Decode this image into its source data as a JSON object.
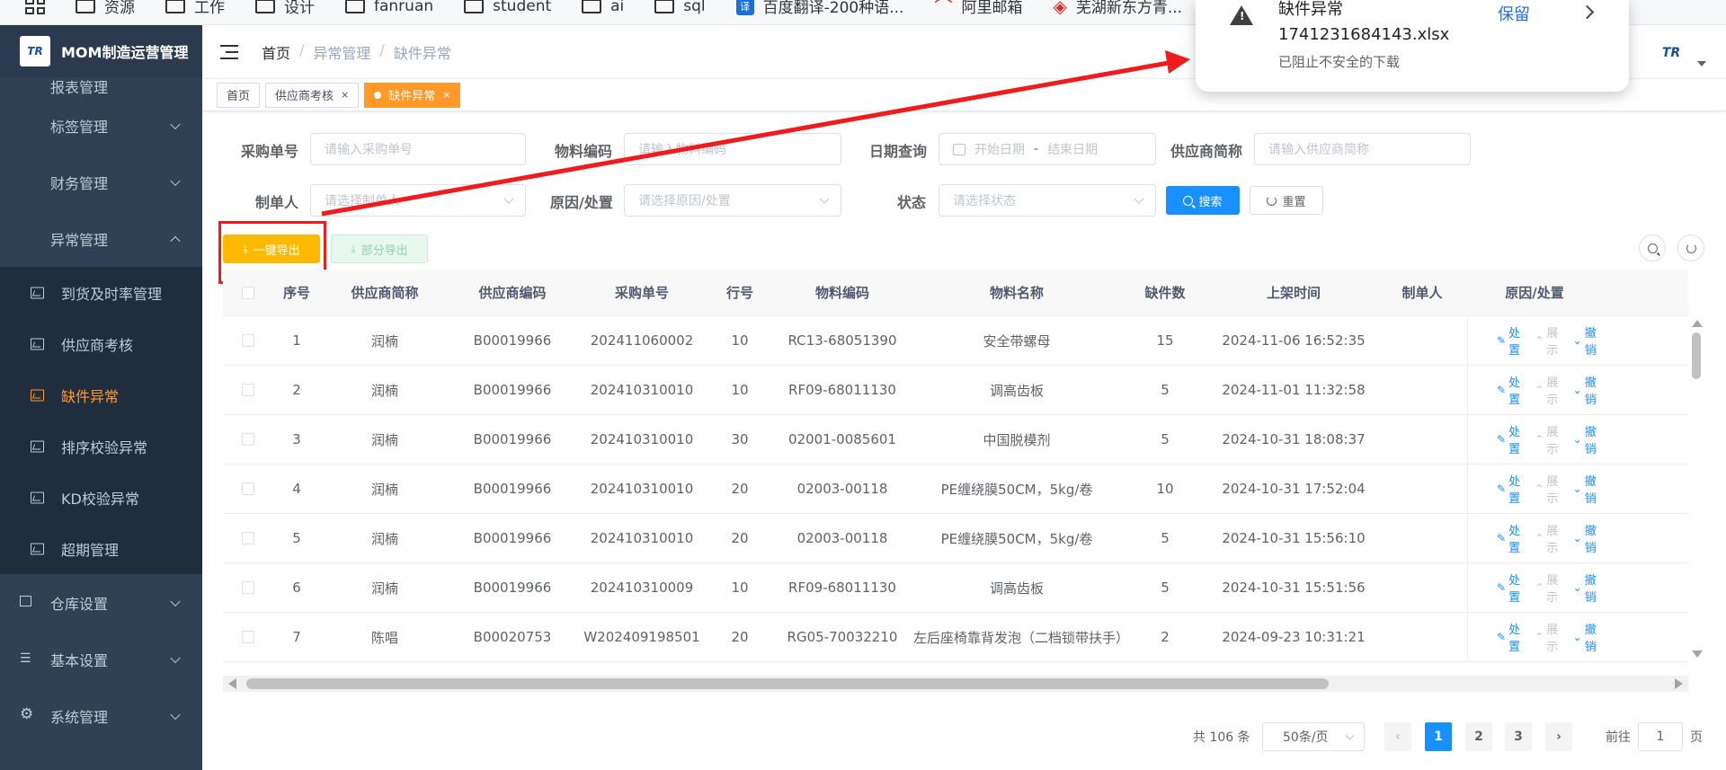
{
  "bookmarks": [
    {
      "icon": "grid-icon",
      "label": ""
    },
    {
      "icon": "folder-icon",
      "label": "资源"
    },
    {
      "icon": "folder-icon",
      "label": "工作"
    },
    {
      "icon": "folder-icon",
      "label": "设计"
    },
    {
      "icon": "folder-icon",
      "label": "fanruan"
    },
    {
      "icon": "folder-icon",
      "label": "student"
    },
    {
      "icon": "folder-icon",
      "label": "ai"
    },
    {
      "icon": "folder-icon",
      "label": "sql"
    },
    {
      "icon": "translate-icon",
      "badge": "译",
      "label": "百度翻译-200种语..."
    },
    {
      "icon": "aliyun-mail-icon",
      "label": "阿里邮箱"
    },
    {
      "icon": "neworiental-icon",
      "label": "芜湖新东方青..."
    }
  ],
  "app": {
    "logo_text": "TR",
    "title": "MOM制造运营管理"
  },
  "sidebar": {
    "partial_top": "报表管理",
    "menus_before": [
      {
        "label": "标签管理"
      },
      {
        "label": "财务管理"
      },
      {
        "label": "异常管理"
      }
    ],
    "sub_items": [
      {
        "label": "到货及时率管理"
      },
      {
        "label": "供应商考核"
      },
      {
        "label": "缺件异常"
      },
      {
        "label": "排序校验异常"
      },
      {
        "label": "KD校验异常"
      },
      {
        "label": "超期管理"
      }
    ],
    "menus_after": [
      {
        "label": "仓库设置"
      },
      {
        "label": "基本设置"
      },
      {
        "label": "系统管理"
      }
    ]
  },
  "navbar": {
    "breadcrumb": [
      "首页",
      "异常管理",
      "缺件异常"
    ],
    "separator": "/",
    "avatar_text": "TR"
  },
  "tags": [
    {
      "label": "首页",
      "closable": false
    },
    {
      "label": "供应商考核",
      "closable": true
    },
    {
      "label": "缺件异常",
      "closable": true
    }
  ],
  "filters": {
    "po_label": "采购单号",
    "po_placeholder": "请输入采购单号",
    "material_label": "物料编码",
    "material_placeholder": "请输入物料编码",
    "date_label": "日期查询",
    "date_start": "开始日期",
    "date_sep": "-",
    "date_end": "结束日期",
    "supplier_label": "供应商简称",
    "supplier_placeholder": "请输入供应商简称",
    "creator_label": "制单人",
    "creator_placeholder": "请选择制单人",
    "reason_label": "原因/处置",
    "reason_placeholder": "请选择原因/处置",
    "status_label": "状态",
    "status_placeholder": "请选择状态",
    "search_btn": "搜索",
    "reset_btn": "重置"
  },
  "toolbar": {
    "export_all": "一键导出",
    "export_partial": "部分导出"
  },
  "table": {
    "headers": [
      "序号",
      "供应商简称",
      "供应商编码",
      "采购单号",
      "行号",
      "物料编码",
      "物料名称",
      "缺件数",
      "上架时间",
      "制单人",
      "原因/处置"
    ],
    "rows": [
      [
        "1",
        "润楠",
        "B00019966",
        "202411060002",
        "10",
        "RC13-68051390",
        "安全带螺母",
        "15",
        "2024-11-06 16:52:35",
        ""
      ],
      [
        "2",
        "润楠",
        "B00019966",
        "202410310010",
        "10",
        "RF09-68011130",
        "调高齿板",
        "5",
        "2024-11-01 11:32:58",
        ""
      ],
      [
        "3",
        "润楠",
        "B00019966",
        "202410310010",
        "30",
        "02001-0085601",
        "中国脱模剂",
        "5",
        "2024-10-31 18:08:37",
        ""
      ],
      [
        "4",
        "润楠",
        "B00019966",
        "202410310010",
        "20",
        "02003-00118",
        "PE缠绕膜50CM，5kg/卷",
        "10",
        "2024-10-31 17:52:04",
        ""
      ],
      [
        "5",
        "润楠",
        "B00019966",
        "202410310010",
        "20",
        "02003-00118",
        "PE缠绕膜50CM，5kg/卷",
        "5",
        "2024-10-31 15:56:10",
        ""
      ],
      [
        "6",
        "润楠",
        "B00019966",
        "202410310009",
        "10",
        "RF09-68011130",
        "调高齿板",
        "5",
        "2024-10-31 15:51:56",
        ""
      ],
      [
        "7",
        "陈唱",
        "B00020753",
        "W202409198501",
        "20",
        "RG05-70032210",
        "左后座椅靠背发泡（二档锁带扶手）",
        "2",
        "2024-09-23 10:31:21",
        ""
      ]
    ],
    "actions": {
      "handle": "处置",
      "expand": "展示",
      "revoke": "撤销"
    }
  },
  "pagination": {
    "total": "共 106 条",
    "page_size": "50条/页",
    "pages": [
      "1",
      "2",
      "3"
    ],
    "current": "1",
    "goto_label": "前往",
    "goto_value": "1",
    "page_unit": "页"
  },
  "download_popup": {
    "title": "缺件异常",
    "filename": "1741231684143.xlsx",
    "note": "已阻止不安全的下载",
    "keep": "保留"
  },
  "colors": {
    "sidebar_bg": "#304156",
    "accent": "#ff9a2a",
    "primary": "#1890ff",
    "warning": "#ffba00",
    "annotation_red": "#ee1c1c"
  }
}
